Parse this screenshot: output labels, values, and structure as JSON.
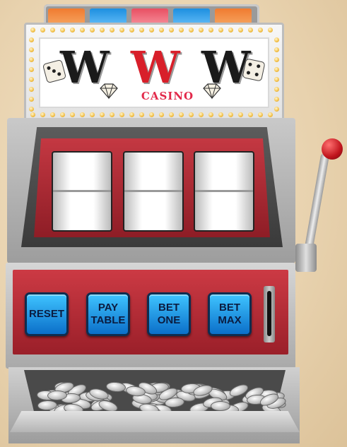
{
  "marquee": {
    "letters": [
      "W",
      "W",
      "W"
    ],
    "letter_colors": [
      "#1a1a1a",
      "#d81f2a",
      "#1a1a1a"
    ],
    "casino_label": "CASINO"
  },
  "top_lights": {
    "colors": [
      "#f06a22",
      "#1d8fe0",
      "#e84f62",
      "#1d8fe0",
      "#f06a22"
    ]
  },
  "buttons": [
    {
      "label": "RESET"
    },
    {
      "label": "PAY\nTABLE"
    },
    {
      "label": "BET\nONE"
    },
    {
      "label": "BET\nMAX"
    }
  ],
  "icons": [
    "dice-icon",
    "diamond-icon",
    "lever-knob",
    "coin-slot"
  ],
  "colors": {
    "cabinet_red": "#b52a35",
    "button_blue": "#1d8fe0"
  }
}
